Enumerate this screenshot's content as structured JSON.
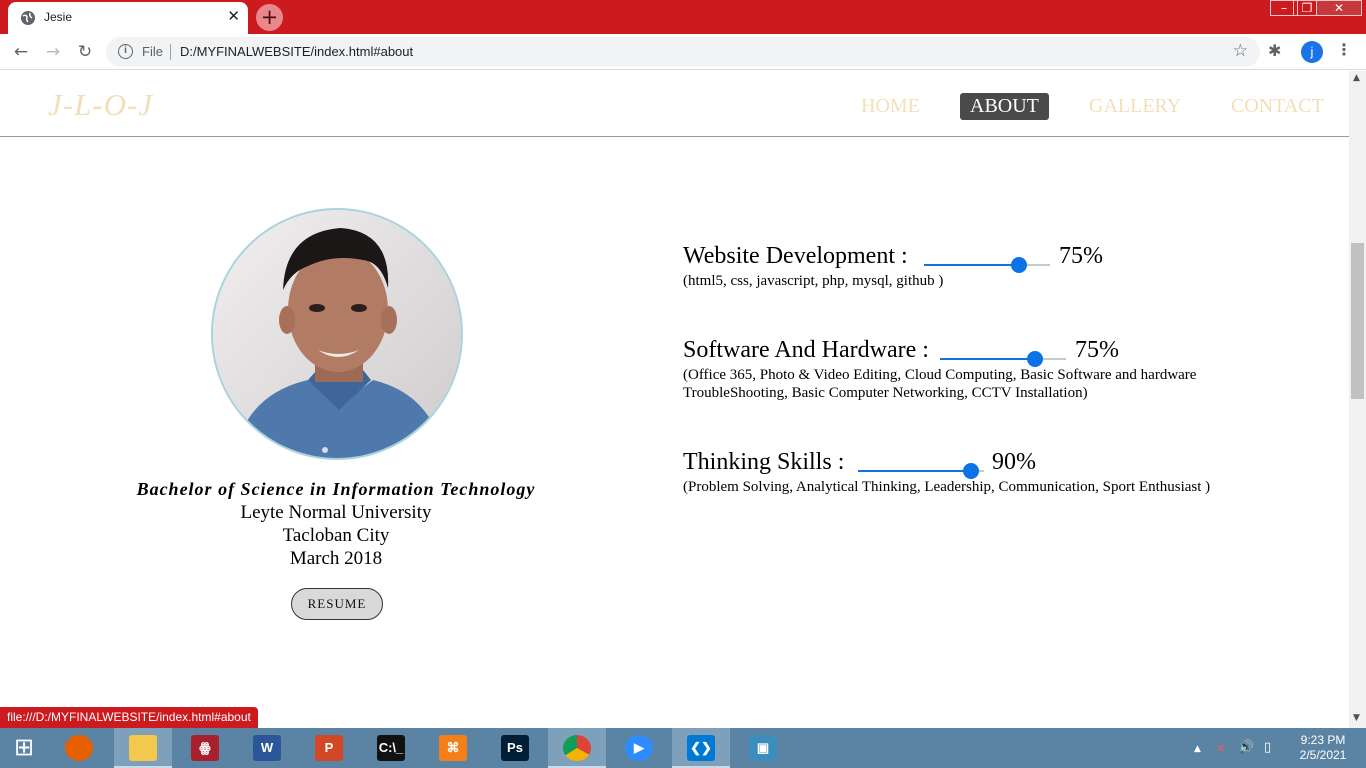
{
  "browser": {
    "tab_title": "Jesie",
    "tab_close": "✕",
    "new_tab": "+",
    "window_controls": [
      "–",
      "❐",
      "✕"
    ],
    "nav": {
      "back": "←",
      "forward": "→",
      "reload": "↻"
    },
    "omnibox": {
      "info_icon": "i",
      "scheme_label": "File",
      "url": "D:/MYFINALWEBSITE/index.html#about",
      "star": "☆"
    },
    "extensions_icon": "✱",
    "profile_initial": "j",
    "menu": "⋮",
    "status_url": "file:///D:/MYFINALWEBSITE/index.html#about"
  },
  "site": {
    "logo": "J-L-O-J",
    "nav": [
      {
        "label": "HOME",
        "active": false
      },
      {
        "label": "ABOUT",
        "active": true
      },
      {
        "label": "GALLERY",
        "active": false
      },
      {
        "label": "CONTACT",
        "active": false
      }
    ]
  },
  "about": {
    "degree": "Bachelor of Science in Information Technology",
    "school": "Leyte Normal University",
    "city": "Tacloban City",
    "date": "March 2018",
    "resume_button": "RESUME",
    "skills": [
      {
        "title": "Website Development :",
        "percent_label": "75%",
        "level": 0.75,
        "desc": "(html5, css, javascript, php, mysql, github )"
      },
      {
        "title": "Software And Hardware :",
        "percent_label": "75%",
        "level": 0.75,
        "desc": "(Office 365, Photo & Video Editing, Cloud Computing, Basic Software and hardware TroubleShooting, Basic Computer Networking, CCTV Installation)"
      },
      {
        "title": "Thinking Skills :",
        "percent_label": "90%",
        "level": 0.9,
        "desc": "(Problem Solving, Analytical Thinking, Leadership, Communication, Sport Enthusiast )"
      }
    ]
  },
  "taskbar": {
    "apps": [
      {
        "name": "windows-start",
        "glyph": "⊞",
        "color": "#5b84a4"
      },
      {
        "name": "firefox",
        "glyph": "",
        "color": "#e66000"
      },
      {
        "name": "file-explorer",
        "glyph": "",
        "color": "#f2c94c"
      },
      {
        "name": "mendeley",
        "glyph": "ꙮ",
        "color": "#a8202b"
      },
      {
        "name": "word",
        "glyph": "W",
        "color": "#2b579a"
      },
      {
        "name": "powerpoint",
        "glyph": "P",
        "color": "#d24726"
      },
      {
        "name": "command-prompt",
        "glyph": "C:\\_",
        "color": "#111111"
      },
      {
        "name": "xampp",
        "glyph": "⌘",
        "color": "#f57f17"
      },
      {
        "name": "photoshop",
        "glyph": "Ps",
        "color": "#001e36"
      },
      {
        "name": "chrome",
        "glyph": "",
        "color": "#4285f4"
      },
      {
        "name": "zoom",
        "glyph": "▶",
        "color": "#2d8cff"
      },
      {
        "name": "vscode",
        "glyph": "❮❯",
        "color": "#0078d4"
      },
      {
        "name": "photos",
        "glyph": "▣",
        "color": "#3c8dbc"
      }
    ],
    "tray": {
      "chevron": "▲",
      "network": "✕",
      "volume": "🔊",
      "battery": "▯"
    },
    "time": "9:23 PM",
    "date": "2/5/2021"
  }
}
